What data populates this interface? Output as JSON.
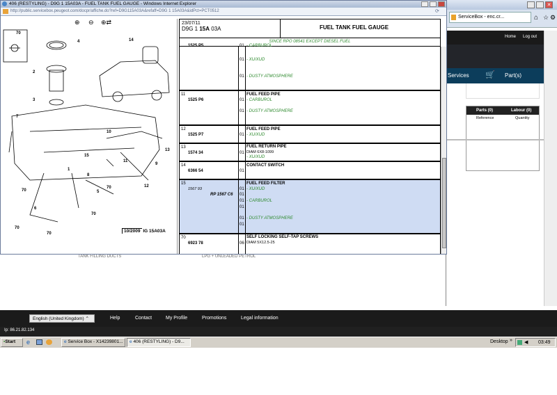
{
  "popup": {
    "title": "406 (RESTYLING) - D9G 1 15A03A - FUEL TANK FUEL GAUGE - Windows Internet Explorer",
    "address": "http://public.servicebox.peugeot.com/docpr/affiche.do?ref=D9G115A03A&refaff=D9G 1 15A03A&idPct=PCT0512",
    "diagram": {
      "zoom_in": "zoom-in",
      "zoom_out": "zoom-out",
      "zoom_fit": "zoom-fit",
      "callouts": [
        "70",
        "4",
        "2",
        "3",
        "14",
        "7",
        "10",
        "11",
        "15",
        "13",
        "9",
        "1",
        "8",
        "5",
        "12",
        "70",
        "70",
        "6",
        "70",
        "70",
        "70"
      ],
      "footer_date": "10/2009",
      "footer_ref": "IG 15A03A"
    },
    "header": {
      "date": "23/07/11",
      "ref_prefix": "D9G 1 ",
      "ref_bold": "15A",
      "ref_suffix": " 03A",
      "title": "FUEL TANK FUEL GAUGE",
      "subtitle": "SINCE RPO 08541 EXCEPT DIESEL FUEL"
    },
    "rows": [
      {
        "num": "",
        "ref": "1525 P5",
        "qtys": [
          "01",
          "01",
          "01"
        ],
        "desc": "",
        "notes": [
          "- CARBUROL",
          "- XU/XUD",
          "- DUSTY ATMOSPHERE"
        ]
      },
      {
        "num": "11",
        "ref": "1525 P6",
        "qtys": [
          "01",
          "01"
        ],
        "desc": "FUEL FEED PIPE",
        "notes": [
          "- CARBUROL",
          "- DUSTY ATMOSPHERE"
        ]
      },
      {
        "num": "12",
        "ref": "1525 P7",
        "qtys": [
          "01"
        ],
        "desc": "FUEL FEED PIPE",
        "notes": [
          "- XU/XUD"
        ]
      },
      {
        "num": "13",
        "ref": "1574 34",
        "qtys": [
          "01"
        ],
        "desc": "FUEL RETURN PIPE",
        "detail": "DIAM 6X8-1099",
        "notes": [
          "- XU/XUD"
        ]
      },
      {
        "num": "14",
        "ref": "6366 54",
        "qtys": [
          "01"
        ],
        "desc": "CONTACT SWITCH",
        "notes": []
      },
      {
        "num": "15",
        "ref": "1567 93",
        "alt_ref": "RP 1567 C6",
        "qtys": [
          "01",
          "01",
          "01",
          "01",
          "01",
          "01"
        ],
        "desc": "FUEL FEED FILTER",
        "notes": [
          "- XU/XUD",
          "- CARBUROL",
          "- DUSTY ATMOSPHERE"
        ]
      },
      {
        "num": "70",
        "ref": "6923 78",
        "qtys": [
          "06"
        ],
        "desc": "SELF LOCKING SELF-TAP SCREWS",
        "detail": "DIAM 5X12.5-25",
        "notes": []
      }
    ]
  },
  "background": {
    "tab_label": "ServiceBox - enc.cr...",
    "nav_home": "Home",
    "nav_logout": "Log out",
    "services_label": "Services",
    "parts_label": "Part(s)",
    "panel_parts_tab": "Parts (0)",
    "panel_labour_tab": "Labour (0)",
    "panel_col_ref": "Reference",
    "panel_col_qty": "Quantity",
    "behind_text_left": "TANK FILLING DUCTS",
    "behind_text_right": "LPG + UNLEADED PETROL"
  },
  "footer": {
    "language": "English (United Kingdom)",
    "links": [
      "Help",
      "Contact",
      "My Profile",
      "Promotions",
      "Legal information"
    ],
    "ip": "Ip: 86.21.82.134"
  },
  "taskbar": {
    "start": "Start",
    "task1": "Service Box - X14239801...",
    "task2": "406 (RESTYLING) - D9...",
    "desktop": "Desktop",
    "clock": "03:49"
  }
}
